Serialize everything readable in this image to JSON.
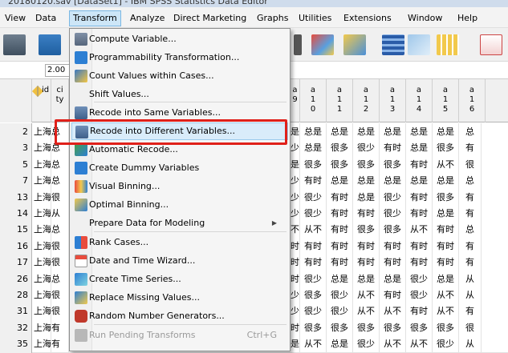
{
  "window": {
    "title": "20180120.sav [DataSet1] - IBM SPSS Statistics Data Editor"
  },
  "menubar": {
    "items": [
      {
        "key": "view",
        "label": "View"
      },
      {
        "key": "data",
        "label": "Data"
      },
      {
        "key": "transform",
        "label": "Transform"
      },
      {
        "key": "analyze",
        "label": "Analyze"
      },
      {
        "key": "direct_marketing",
        "label": "Direct Marketing"
      },
      {
        "key": "graphs",
        "label": "Graphs"
      },
      {
        "key": "utilities",
        "label": "Utilities"
      },
      {
        "key": "extensions",
        "label": "Extensions"
      },
      {
        "key": "window",
        "label": "Window"
      },
      {
        "key": "help",
        "label": "Help"
      }
    ]
  },
  "cellref": {
    "value": "2.00"
  },
  "grid": {
    "left_headers": [
      {
        "label": "id"
      },
      {
        "label": "ci ty"
      }
    ],
    "right_headers": [
      {
        "top": "a",
        "bottom": "9"
      },
      {
        "top": "a",
        "bottom": "0"
      },
      {
        "top": "a",
        "bottom": "1"
      },
      {
        "top": "a",
        "bottom": "2"
      },
      {
        "top": "a",
        "bottom": "3"
      },
      {
        "top": "a",
        "bottom": "4"
      },
      {
        "top": "a",
        "bottom": "5"
      },
      {
        "top": "a",
        "bottom": "6"
      }
    ],
    "right_header_mid": [
      "",
      "1",
      "1",
      "1",
      "1",
      "1",
      "1",
      "1"
    ],
    "rows": [
      {
        "n": "2",
        "city": "上海",
        "c": "总",
        "vals": [
          "是",
          "总是",
          "总是",
          "总是",
          "总是",
          "总是",
          "总是",
          "总"
        ]
      },
      {
        "n": "3",
        "city": "上海",
        "c": "总",
        "vals": [
          "少",
          "总是",
          "很多",
          "很少",
          "有时",
          "总是",
          "很多",
          "有"
        ]
      },
      {
        "n": "5",
        "city": "上海",
        "c": "总",
        "vals": [
          "是",
          "很多",
          "很多",
          "很多",
          "很多",
          "有时",
          "从不",
          "很"
        ]
      },
      {
        "n": "7",
        "city": "上海",
        "c": "总",
        "vals": [
          "少",
          "有时",
          "总是",
          "总是",
          "总是",
          "总是",
          "总是",
          "总"
        ]
      },
      {
        "n": "13",
        "city": "上海",
        "c": "很",
        "vals": [
          "少",
          "很少",
          "有时",
          "总是",
          "很少",
          "有时",
          "很多",
          "有"
        ]
      },
      {
        "n": "14",
        "city": "上海",
        "c": "从",
        "vals": [
          "少",
          "很少",
          "有时",
          "有时",
          "很少",
          "有时",
          "总是",
          "有"
        ]
      },
      {
        "n": "15",
        "city": "上海",
        "c": "总",
        "vals": [
          "不",
          "从不",
          "有时",
          "很多",
          "很多",
          "从不",
          "有时",
          "总"
        ]
      },
      {
        "n": "16",
        "city": "上海",
        "c": "很",
        "vals": [
          "时",
          "有时",
          "有时",
          "有时",
          "有时",
          "有时",
          "有时",
          "有"
        ]
      },
      {
        "n": "17",
        "city": "上海",
        "c": "很",
        "vals": [
          "时",
          "有时",
          "有时",
          "有时",
          "有时",
          "有时",
          "有时",
          "有"
        ]
      },
      {
        "n": "26",
        "city": "上海",
        "c": "总",
        "vals": [
          "时",
          "很少",
          "总是",
          "总是",
          "总是",
          "很少",
          "总是",
          "从"
        ]
      },
      {
        "n": "28",
        "city": "上海",
        "c": "很",
        "vals": [
          "少",
          "很多",
          "很少",
          "从不",
          "有时",
          "很少",
          "从不",
          "从"
        ]
      },
      {
        "n": "31",
        "city": "上海",
        "c": "很",
        "vals": [
          "少",
          "很少",
          "很少",
          "从不",
          "从不",
          "有时",
          "从不",
          "有"
        ]
      },
      {
        "n": "32",
        "city": "上海",
        "c": "有",
        "vals": [
          "时",
          "很多",
          "很多",
          "很多",
          "很多",
          "很多",
          "很多",
          "很"
        ]
      },
      {
        "n": "35",
        "city": "上海",
        "c": "有",
        "vals": [
          "是",
          "从不",
          "总是",
          "很少",
          "从不",
          "从不",
          "很少",
          "从"
        ]
      }
    ]
  },
  "transform_menu": {
    "items": [
      {
        "key": "compute",
        "label": "Compute Variable...",
        "icon": "calculator-icon"
      },
      {
        "key": "programmability",
        "label": "Programmability Transformation...",
        "icon": "plus-icon"
      },
      {
        "key": "count",
        "label": "Count Values within Cases...",
        "icon": "count-icon"
      },
      {
        "key": "shift",
        "label": "Shift Values...",
        "icon": ""
      },
      {
        "key": "recode_same",
        "label": "Recode into Same Variables...",
        "icon": "recode-same-icon"
      },
      {
        "key": "recode_diff",
        "label": "Recode into Different Variables...",
        "icon": "recode-different-icon"
      },
      {
        "key": "auto_recode",
        "label": "Automatic Recode...",
        "icon": "auto-recode-icon"
      },
      {
        "key": "dummy",
        "label": "Create Dummy Variables",
        "icon": "plus-icon"
      },
      {
        "key": "visual_binning",
        "label": "Visual Binning...",
        "icon": "visual-binning-icon"
      },
      {
        "key": "optimal_binning",
        "label": "Optimal Binning...",
        "icon": "optimal-binning-icon"
      },
      {
        "key": "prepare",
        "label": "Prepare Data for Modeling",
        "icon": ""
      },
      {
        "key": "rank",
        "label": "Rank Cases...",
        "icon": "rank-icon"
      },
      {
        "key": "datetime",
        "label": "Date and Time Wizard...",
        "icon": "calendar-icon"
      },
      {
        "key": "timeseries",
        "label": "Create Time Series...",
        "icon": "time-series-icon"
      },
      {
        "key": "missing",
        "label": "Replace Missing Values...",
        "icon": "replace-missing-icon"
      },
      {
        "key": "random",
        "label": "Random Number Generators...",
        "icon": "dice-icon"
      },
      {
        "key": "pending",
        "label": "Run Pending Transforms",
        "icon": "run-icon",
        "shortcut": "Ctrl+G"
      }
    ]
  },
  "colors": {
    "highlight": "#e0201a",
    "menu_hover": "#d9ecfa",
    "active_menu": "#cde6f7"
  }
}
